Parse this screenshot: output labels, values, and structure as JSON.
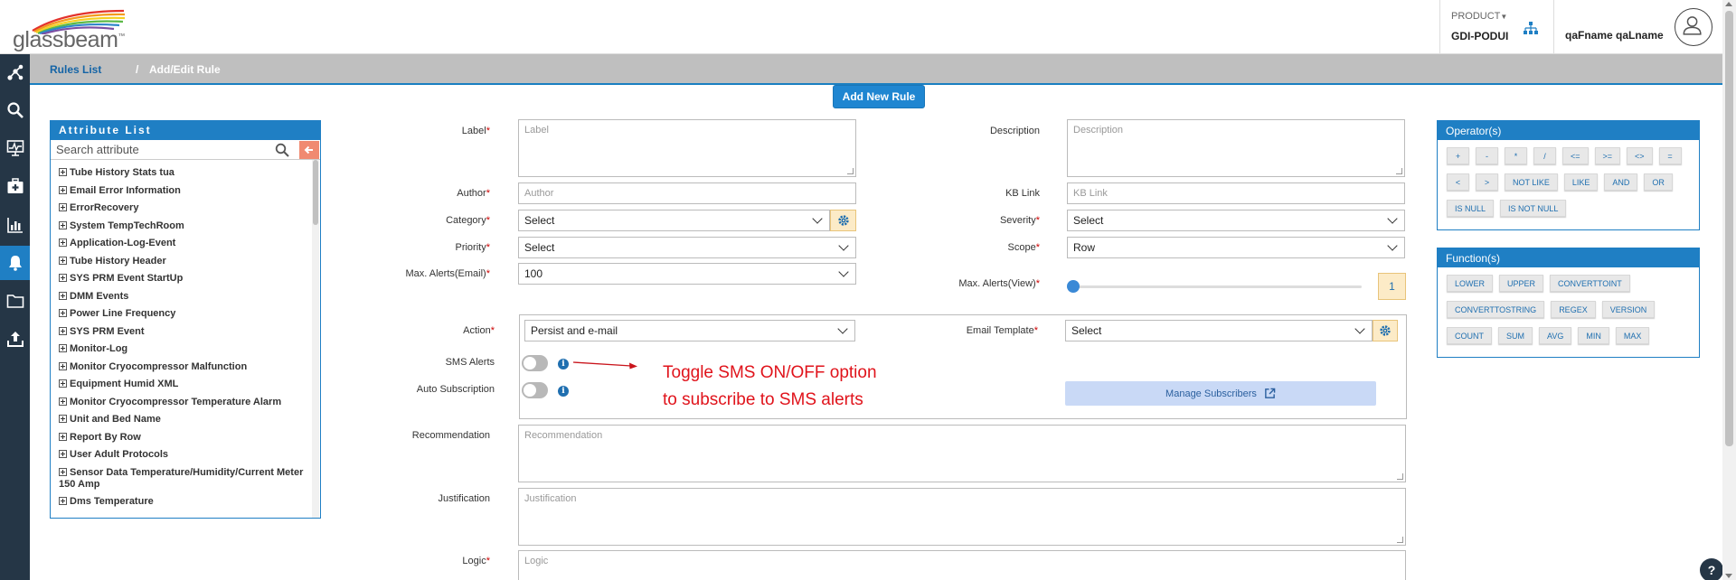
{
  "header": {
    "brand": "glassbeam",
    "brand_tm": "™",
    "product_label": "PRODUCT",
    "product_value": "GDI-PODUI",
    "user_name": "qaFname qaLname"
  },
  "sidenav": {
    "items": [
      "network-icon",
      "search-icon",
      "monitor-icon",
      "medkit-icon",
      "bar-chart-icon",
      "bell-icon",
      "folder-icon",
      "upload-icon"
    ],
    "active_index": 5
  },
  "breadcrumb": {
    "link": "Rules List",
    "separator": "/",
    "current": "Add/Edit Rule"
  },
  "add_rule_button": "Add New Rule",
  "attribute_list": {
    "title": "Attribute List",
    "search_placeholder": "Search attribute",
    "items": [
      "Tube History Stats tua",
      "Email Error Information",
      "ErrorRecovery",
      "System TempTechRoom",
      "Application-Log-Event",
      "Tube History Header",
      "SYS PRM Event StartUp",
      "DMM Events",
      "Power Line Frequency",
      "SYS PRM Event",
      "Monitor-Log",
      "Monitor Cryocompressor Malfunction",
      "Equipment Humid XML",
      "Monitor Cryocompressor Temperature Alarm",
      "Unit and Bed Name",
      "Report By Row",
      "User Adult Protocols",
      "Sensor Data Temperature/Humidity/Current Meter 150 Amp",
      "Dms Temperature"
    ]
  },
  "form": {
    "label": {
      "label": "Label",
      "placeholder": "Label"
    },
    "description": {
      "label": "Description",
      "placeholder": "Description"
    },
    "author": {
      "label": "Author",
      "placeholder": "Author"
    },
    "kb_link": {
      "label": "KB Link",
      "placeholder": "KB Link"
    },
    "category": {
      "label": "Category",
      "value": "Select"
    },
    "severity": {
      "label": "Severity",
      "value": "Select"
    },
    "priority": {
      "label": "Priority",
      "value": "Select"
    },
    "scope": {
      "label": "Scope",
      "value": "Row"
    },
    "max_alerts_email": {
      "label": "Max. Alerts(Email)",
      "value": "100"
    },
    "max_alerts_view": {
      "label": "Max. Alerts(View)",
      "value": "1"
    },
    "action": {
      "label": "Action",
      "value": "Persist and e-mail"
    },
    "email_template": {
      "label": "Email Template",
      "value": "Select"
    },
    "sms_alerts": {
      "label": "SMS Alerts"
    },
    "auto_subscription": {
      "label": "Auto Subscription"
    },
    "manage_subscribers": "Manage Subscribers",
    "recommendation": {
      "label": "Recommendation",
      "placeholder": "Recommendation"
    },
    "justification": {
      "label": "Justification",
      "placeholder": "Justification"
    },
    "logic": {
      "label": "Logic",
      "placeholder": "Logic"
    },
    "required_mark": "*"
  },
  "annotation": "Toggle SMS ON/OFF option to subscribe to SMS alerts",
  "operators": {
    "title": "Operator(s)",
    "items": [
      "+",
      "-",
      "*",
      "/",
      "<=",
      ">=",
      "<>",
      "=",
      "<",
      ">",
      "NOT LIKE",
      "LIKE",
      "AND",
      "OR",
      "IS NULL",
      "IS NOT NULL"
    ]
  },
  "functions": {
    "title": "Function(s)",
    "items": [
      "LOWER",
      "UPPER",
      "CONVERTTOINT",
      "CONVERTTOSTRING",
      "REGEX",
      "VERSION",
      "COUNT",
      "SUM",
      "AVG",
      "MIN",
      "MAX"
    ]
  },
  "help_label": "?",
  "colors": {
    "nav_bg": "#253646",
    "accent": "#1f7fc4",
    "annotation": "#e0131b"
  }
}
